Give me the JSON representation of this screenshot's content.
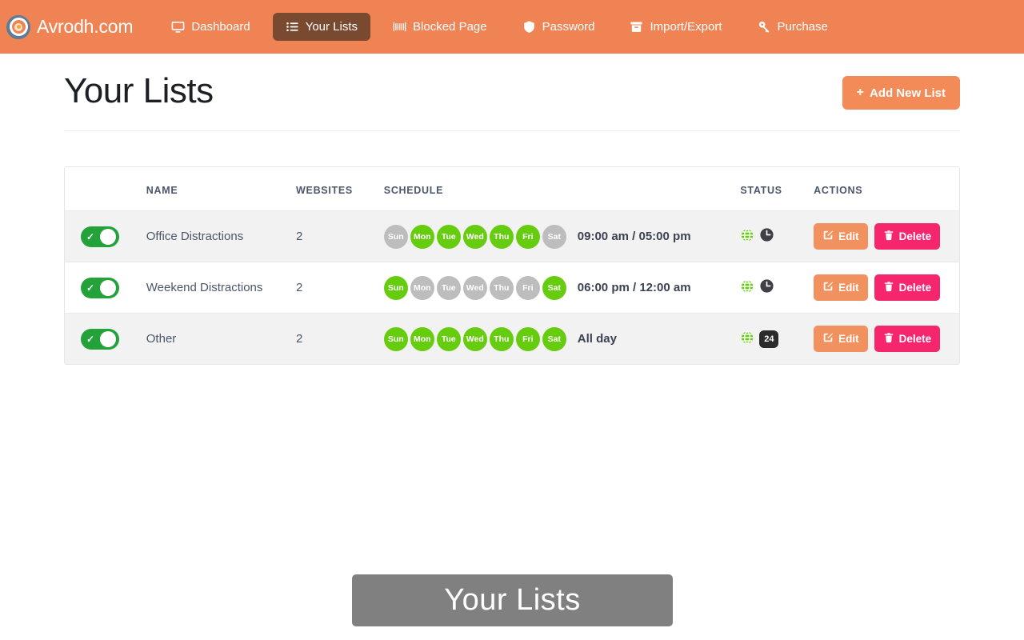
{
  "navbar": {
    "brand": {
      "name": "Avrodh.com",
      "logo_icon": "bullseye-target-icon"
    },
    "background_color": "#ef8354",
    "active_pill_color": "#7a4a30",
    "items": [
      {
        "label": "Dashboard",
        "icon": "monitor-icon",
        "active": false
      },
      {
        "label": "Your Lists",
        "icon": "list-icon",
        "active": true
      },
      {
        "label": "Blocked Page",
        "icon": "blocked-wall-icon",
        "active": false
      },
      {
        "label": "Password",
        "icon": "shield-icon",
        "active": false
      },
      {
        "label": "Import/Export",
        "icon": "archive-box-icon",
        "active": false
      },
      {
        "label": "Purchase",
        "icon": "key-icon",
        "active": false
      }
    ]
  },
  "page": {
    "title": "Your Lists",
    "add_button": {
      "label": "Add New List",
      "plus": "+",
      "color": "#f28b58"
    }
  },
  "table": {
    "headers": [
      "",
      "NAME",
      "WEBSITES",
      "SCHEDULE",
      "STATUS",
      "ACTIONS"
    ],
    "day_labels": [
      "Sun",
      "Mon",
      "Tue",
      "Wed",
      "Thu",
      "Fri",
      "Sat"
    ],
    "colors": {
      "day_on": "#66cc0f",
      "day_off": "#bdbdbd",
      "toggle_on": "#22a238",
      "edit": "#f0915f",
      "delete": "#f5256e"
    },
    "buttons": {
      "edit_label": "Edit",
      "delete_label": "Delete",
      "edit_icon": "pencil-square-icon",
      "delete_icon": "trash-icon"
    },
    "rows": [
      {
        "enabled": true,
        "name": "Office Distractions",
        "websites": "2",
        "days": [
          false,
          true,
          true,
          true,
          true,
          true,
          false
        ],
        "time": "09:00 am / 05:00 pm",
        "status_icons": [
          "globe-icon",
          "clock-icon"
        ],
        "status_badge": null
      },
      {
        "enabled": true,
        "name": "Weekend Distractions",
        "websites": "2",
        "days": [
          true,
          false,
          false,
          false,
          false,
          false,
          true
        ],
        "time": "06:00 pm / 12:00 am",
        "status_icons": [
          "globe-icon",
          "clock-icon"
        ],
        "status_badge": null
      },
      {
        "enabled": true,
        "name": "Other",
        "websites": "2",
        "days": [
          true,
          true,
          true,
          true,
          true,
          true,
          true
        ],
        "time": "All day",
        "status_icons": [
          "globe-icon"
        ],
        "status_badge": "24"
      }
    ]
  },
  "caption": {
    "text": "Your Lists"
  }
}
